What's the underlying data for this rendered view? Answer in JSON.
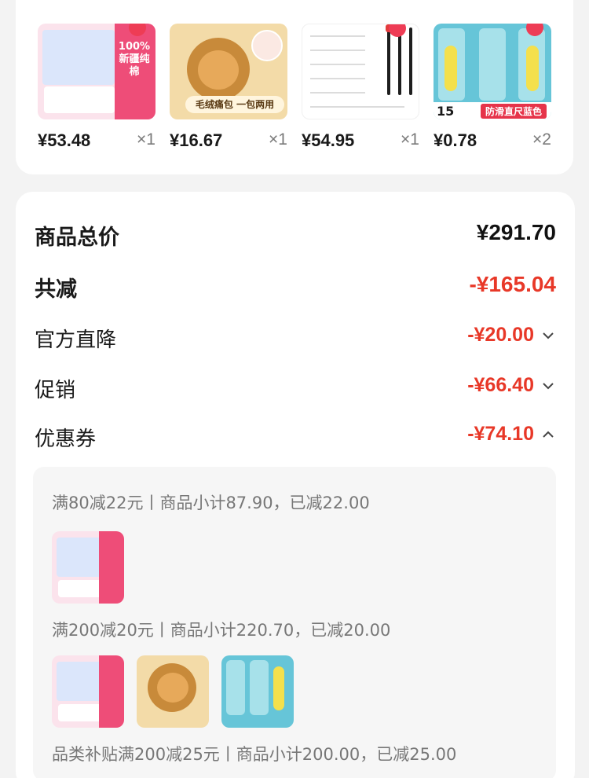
{
  "items": [
    {
      "price": "¥53.48",
      "qty": "×1",
      "image_icon": "sanitary-pad-product-image",
      "badge_text": "100%新疆纯棉"
    },
    {
      "price": "¥16.67",
      "qty": "×1",
      "image_icon": "plush-bear-bag-product-image",
      "badge_text": "毛绒痛包 一包两用"
    },
    {
      "price": "¥54.95",
      "qty": "×1",
      "image_icon": "pen-set-product-image"
    },
    {
      "price": "¥0.78",
      "qty": "×2",
      "image_icon": "ruler-product-image",
      "badge_text": "防滑直尺蓝色",
      "size_text": "15"
    }
  ],
  "summary": {
    "total_label": "商品总价",
    "total_value": "¥291.70",
    "reduce_label": "共减",
    "reduce_value": "-¥165.04",
    "official_label": "官方直降",
    "official_value": "-¥20.00",
    "promo_label": "促销",
    "promo_value": "-¥66.40",
    "coupon_label": "优惠券",
    "coupon_value": "-¥74.10"
  },
  "coupons": [
    {
      "text": "满80减22元丨商品小计87.90，已减22.00"
    },
    {
      "text": "满200减20元丨商品小计220.70，已减20.00"
    },
    {
      "text": "品类补贴满200减25元丨商品小计200.00，已减25.00"
    }
  ],
  "colors": {
    "accent_red": "#e83828",
    "background": "#f3f3f3"
  }
}
